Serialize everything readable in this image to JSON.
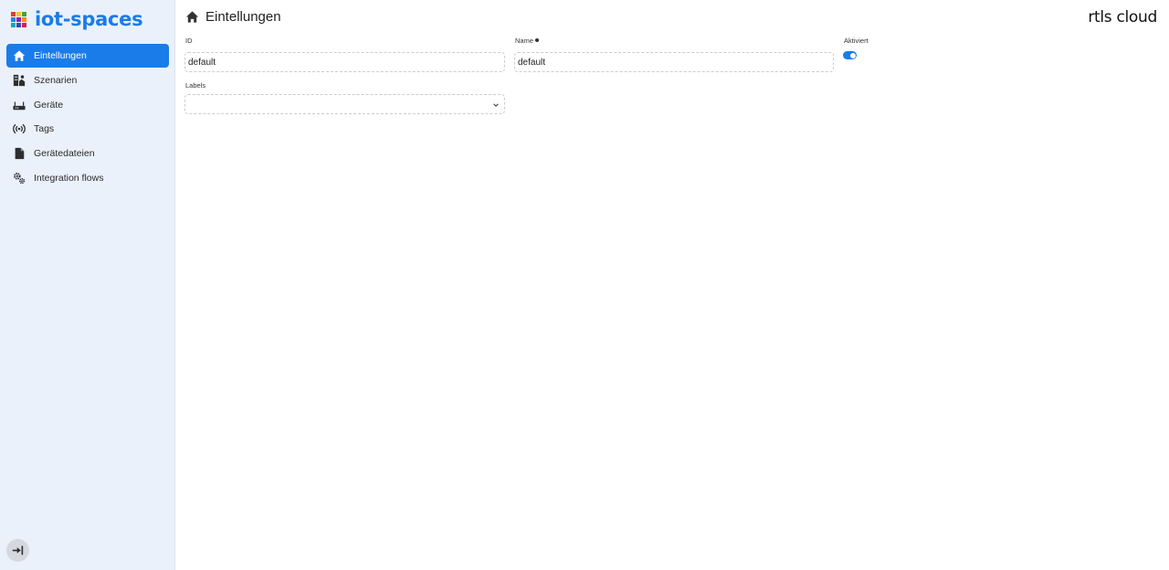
{
  "brand": {
    "name": "iot-spaces",
    "icon": "brand-grid-icon",
    "grid_colors": [
      "#e53935",
      "#fbc02d",
      "#43a047",
      "#1e88e5",
      "#8e24aa",
      "#fb8c00",
      "#00acc1",
      "#3949ab",
      "#d81b60"
    ],
    "accent_color": "#1a7ce8"
  },
  "sidebar": {
    "items": [
      {
        "label": "Eintellungen",
        "icon": "home-icon",
        "active": true
      },
      {
        "label": "Szenarien",
        "icon": "scenarios-icon",
        "active": false
      },
      {
        "label": "Geräte",
        "icon": "router-icon",
        "active": false
      },
      {
        "label": "Tags",
        "icon": "broadcast-icon",
        "active": false
      },
      {
        "label": "Gerätedateien",
        "icon": "file-icon",
        "active": false
      },
      {
        "label": "Integration flows",
        "icon": "gears-icon",
        "active": false
      }
    ],
    "logout_icon": "logout-icon"
  },
  "header": {
    "title": "Eintellungen",
    "icon": "home-icon",
    "logo_text": "rtls cloud"
  },
  "form": {
    "id_label": "ID",
    "id_value": "default",
    "name_label": "Name",
    "name_value": "default",
    "enabled_label": "Aktiviert",
    "enabled": true,
    "labels_label": "Labels",
    "labels_value": ""
  }
}
